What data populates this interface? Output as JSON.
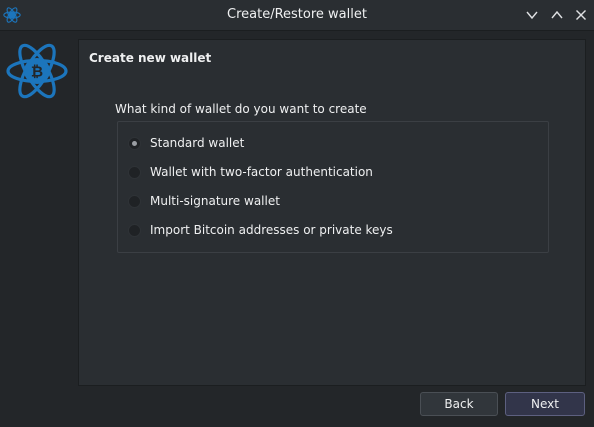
{
  "window": {
    "title": "Create/Restore wallet",
    "controls": [
      "minimize",
      "maximize",
      "close"
    ]
  },
  "logo": {
    "icon": "electrum-bitcoin-logo-icon",
    "color": "#1c75bc"
  },
  "panel": {
    "heading": "Create new wallet",
    "question": "What kind of wallet do you want to create",
    "options": [
      {
        "label": "Standard wallet",
        "selected": true
      },
      {
        "label": "Wallet with two-factor authentication",
        "selected": false
      },
      {
        "label": "Multi-signature wallet",
        "selected": false
      },
      {
        "label": "Import Bitcoin addresses or private keys",
        "selected": false
      }
    ]
  },
  "buttons": {
    "back": "Back",
    "next": "Next"
  }
}
